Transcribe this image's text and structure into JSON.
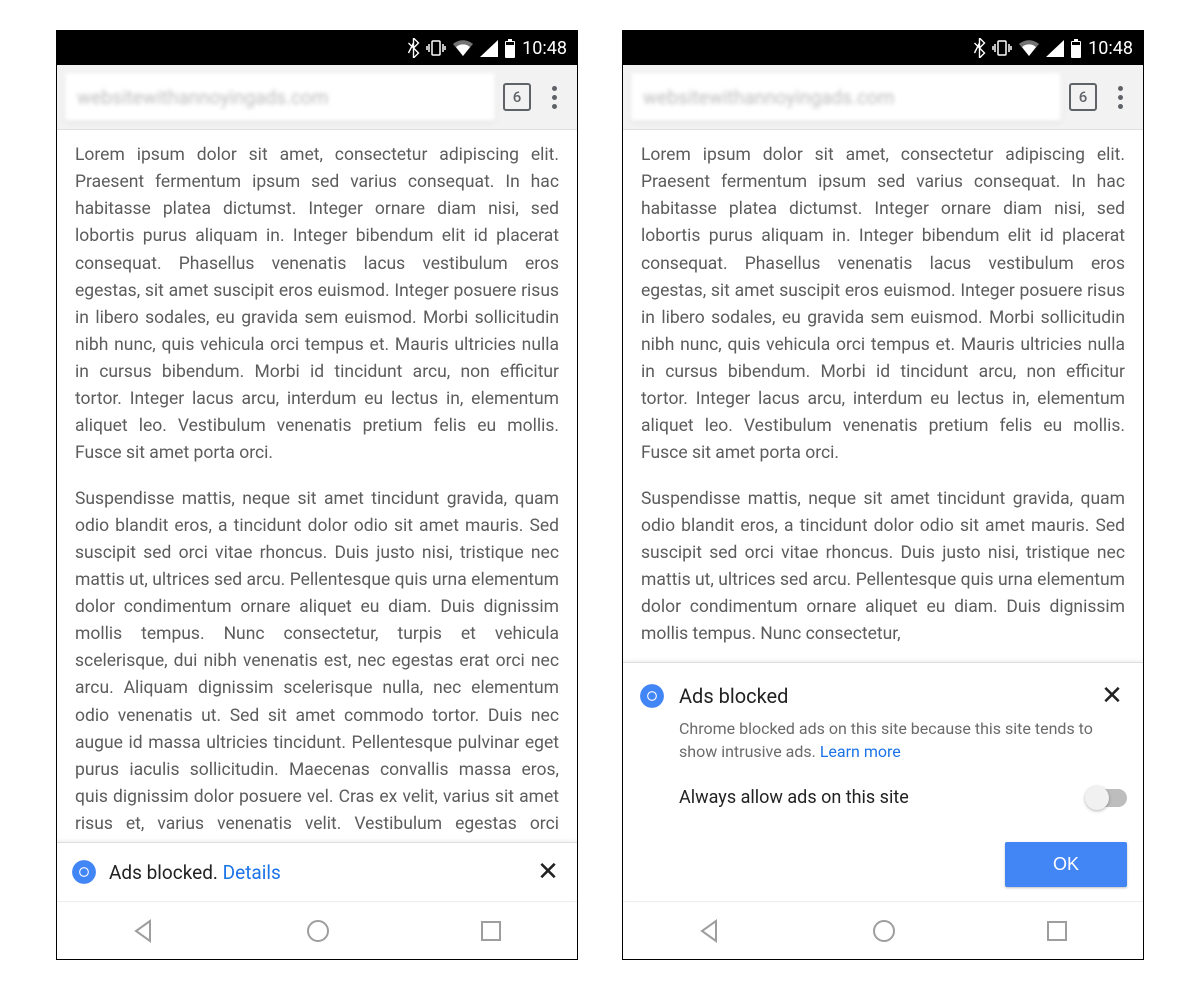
{
  "status": {
    "time": "10:48"
  },
  "omnibox": {
    "url_blurred": "websitewithannoyingads.com",
    "tab_count": "6"
  },
  "body_text": {
    "p1": "Lorem ipsum dolor sit amet, consectetur adipiscing elit. Praesent fermentum ipsum sed varius consequat. In hac habitasse platea dictumst. Integer ornare diam nisi, sed lobortis purus aliquam in. Integer bibendum elit id placerat consequat. Phasellus venenatis lacus vestibulum eros egestas, sit amet suscipit eros euismod. Integer posuere risus in libero sodales, eu gravida sem euismod. Morbi sollicitudin nibh nunc, quis vehicula orci tempus et. Mauris ultricies nulla in cursus bibendum. Morbi id tincidunt arcu, non efficitur tortor. Integer lacus arcu, interdum eu lectus in, elementum aliquet leo. Vestibulum venenatis pretium felis eu mollis. Fusce sit amet porta orci.",
    "p2": "Suspendisse mattis, neque sit amet tincidunt gravida, quam odio blandit eros, a tincidunt dolor odio sit amet mauris. Sed suscipit sed orci vitae rhoncus. Duis justo nisi, tristique nec mattis ut, ultrices sed arcu. Pellentesque quis urna elementum dolor condimentum ornare aliquet eu diam. Duis dignissim mollis tempus. Nunc consectetur, turpis et vehicula scelerisque, dui nibh venenatis est, nec egestas erat orci nec arcu. Aliquam dignissim scelerisque nulla, nec elementum odio venenatis ut. Sed sit amet commodo tortor. Duis nec augue id massa ultricies tincidunt. Pellentesque pulvinar eget purus iaculis sollicitudin. Maecenas convallis massa eros, quis dignissim dolor posuere vel. Cras ex velit, varius sit amet risus et, varius venenatis velit. Vestibulum egestas orci venenatis",
    "p2_short": "Suspendisse mattis, neque sit amet tincidunt gravida, quam odio blandit eros, a tincidunt dolor odio sit amet mauris. Sed suscipit sed orci vitae rhoncus. Duis justo nisi, tristique nec mattis ut, ultrices sed arcu. Pellentesque quis urna elementum dolor condimentum ornare aliquet eu diam. Duis dignissim mollis tempus. Nunc consectetur,"
  },
  "collapsed": {
    "title": "Ads blocked.",
    "details_link": "Details"
  },
  "expanded": {
    "title": "Ads blocked",
    "description": "Chrome blocked ads on this site because this site tends to show intrusive ads. ",
    "learn_more": "Learn more",
    "toggle_label": "Always allow ads on this site",
    "ok": "OK"
  }
}
